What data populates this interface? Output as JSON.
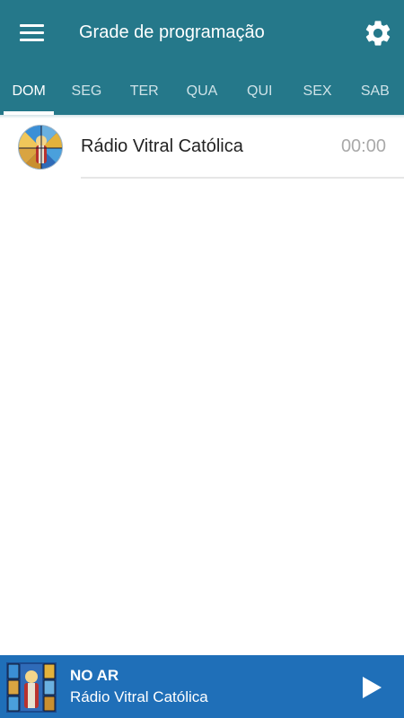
{
  "colors": {
    "appbar": "#25788a",
    "player_bar": "#1f6fb8",
    "tab_active": "#ffffff",
    "tab_inactive": "#cfe3e8"
  },
  "toolbar": {
    "menu_icon": "hamburger-menu-icon",
    "title": "Grade de programação",
    "settings_icon": "gear-icon"
  },
  "tabs": [
    {
      "label": "DOM",
      "active": true
    },
    {
      "label": "SEG",
      "active": false
    },
    {
      "label": "TER",
      "active": false
    },
    {
      "label": "QUA",
      "active": false
    },
    {
      "label": "QUI",
      "active": false
    },
    {
      "label": "SEX",
      "active": false
    },
    {
      "label": "SAB",
      "active": false
    }
  ],
  "schedule": [
    {
      "title": "Rádio Vitral Católica",
      "time": "00:00",
      "image": "stained-glass-logo"
    }
  ],
  "player": {
    "status": "NO AR",
    "station": "Rádio Vitral Católica",
    "play_icon": "play-icon"
  }
}
